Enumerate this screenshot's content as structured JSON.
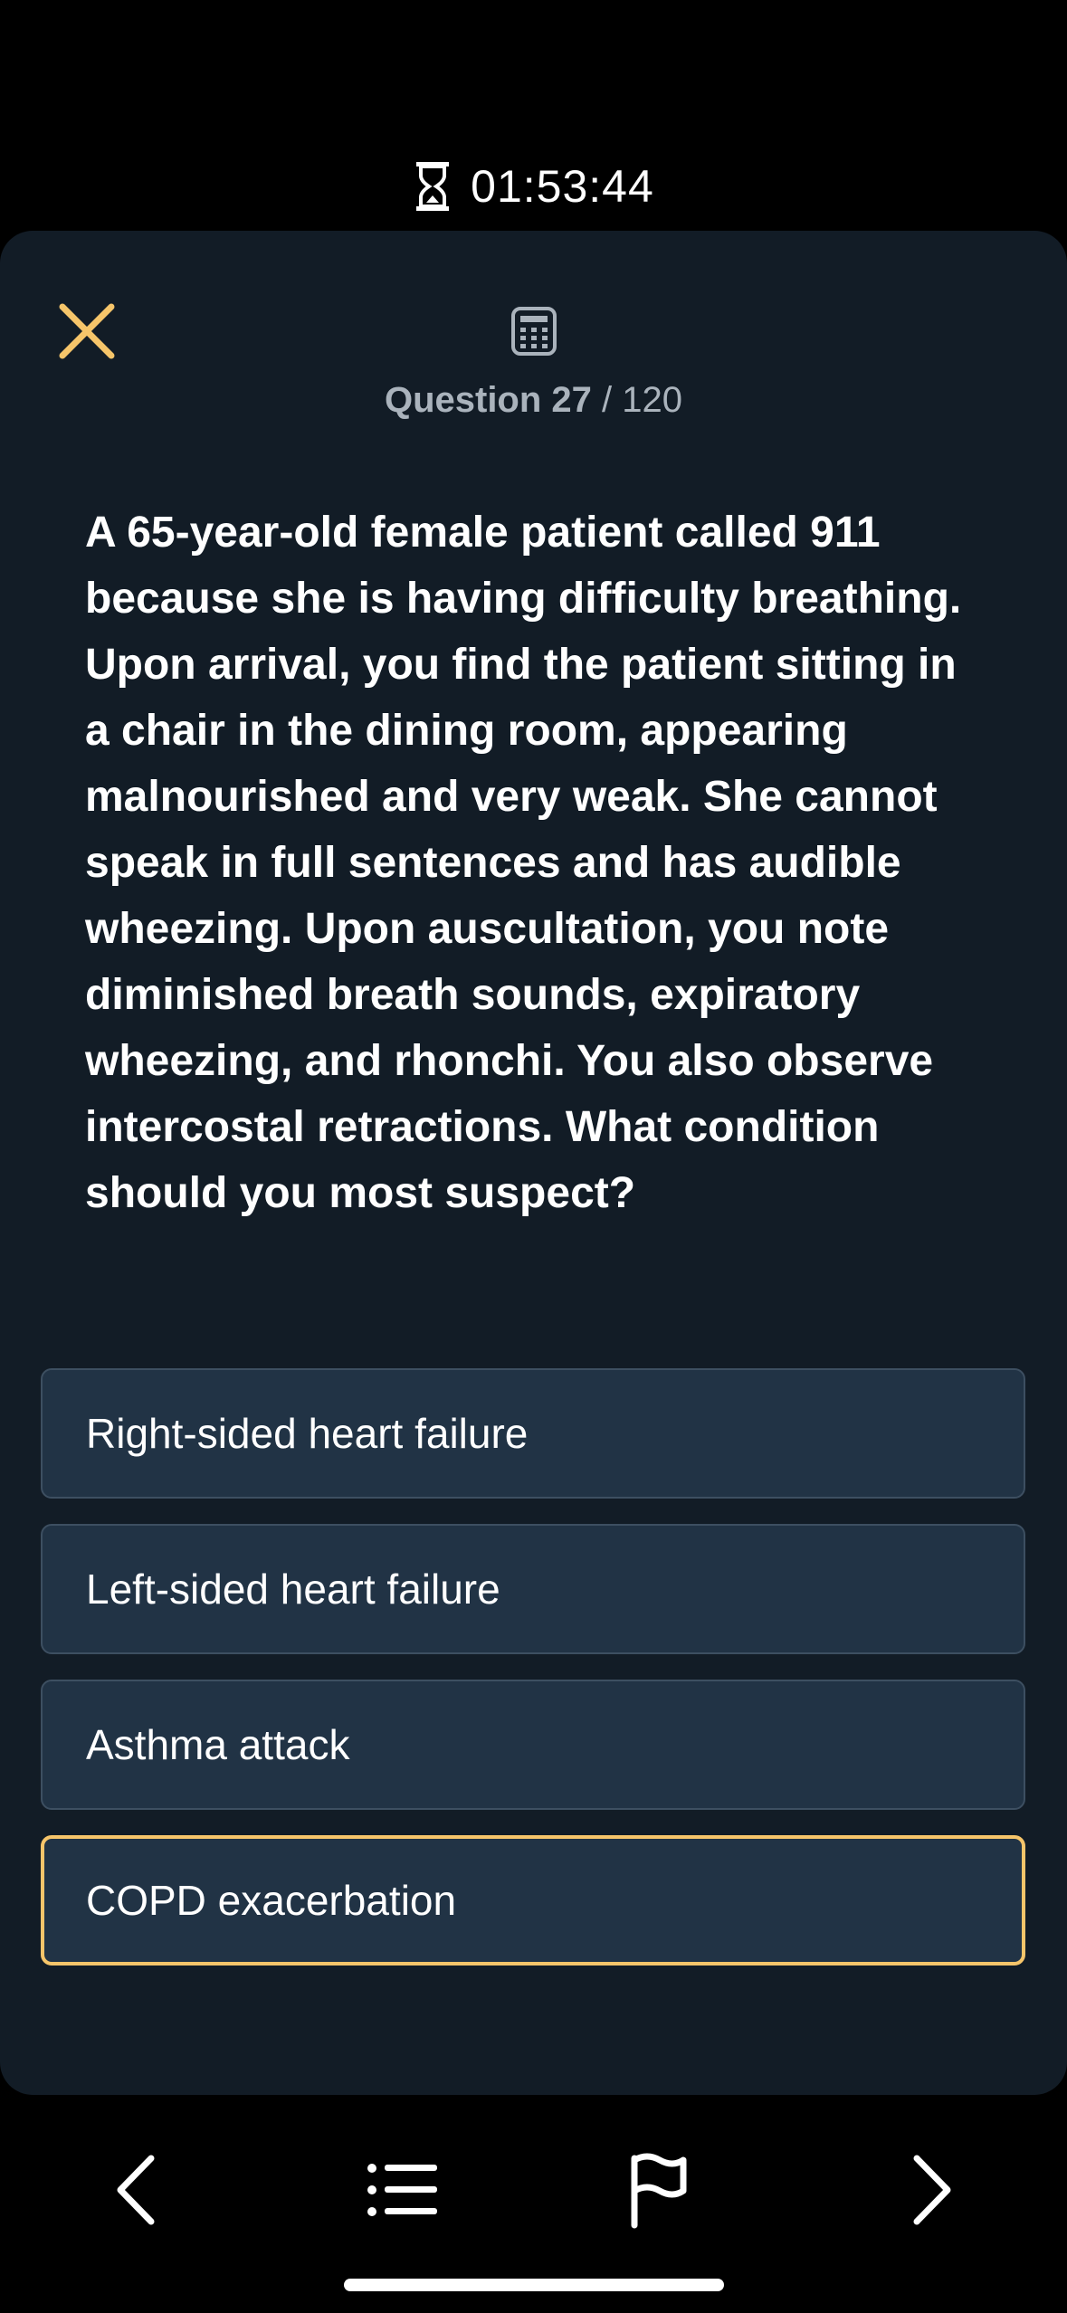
{
  "timer": {
    "icon": "hourglass-icon",
    "value": "01:53:44"
  },
  "header": {
    "close_icon": "close-icon",
    "calculator_icon": "calculator-icon",
    "question_label": "Question",
    "question_current": "27",
    "question_separator": "/",
    "question_total": "120"
  },
  "question": {
    "text": "A 65-year-old female patient called 911 because she is having difficulty breathing. Upon arrival, you find the patient sitting in a chair in the dining room, appearing malnourished and very weak. She cannot speak in full sentences and has audible wheezing. Upon auscultation, you note diminished breath sounds, expiratory wheezing, and rhonchi. You also observe intercostal retractions. What condition should you most suspect?"
  },
  "answers": [
    {
      "label": "Right-sided heart failure",
      "selected": false
    },
    {
      "label": "Left-sided heart failure",
      "selected": false
    },
    {
      "label": "Asthma attack",
      "selected": false
    },
    {
      "label": "COPD exacerbation",
      "selected": true
    }
  ],
  "bottom_nav": {
    "previous_icon": "chevron-left-icon",
    "list_icon": "list-icon",
    "flag_icon": "flag-icon",
    "next_icon": "chevron-right-icon"
  },
  "colors": {
    "accent": "#f6c56a",
    "card_background": "#121c26",
    "answer_background": "#213345",
    "screen_background": "#000000"
  }
}
